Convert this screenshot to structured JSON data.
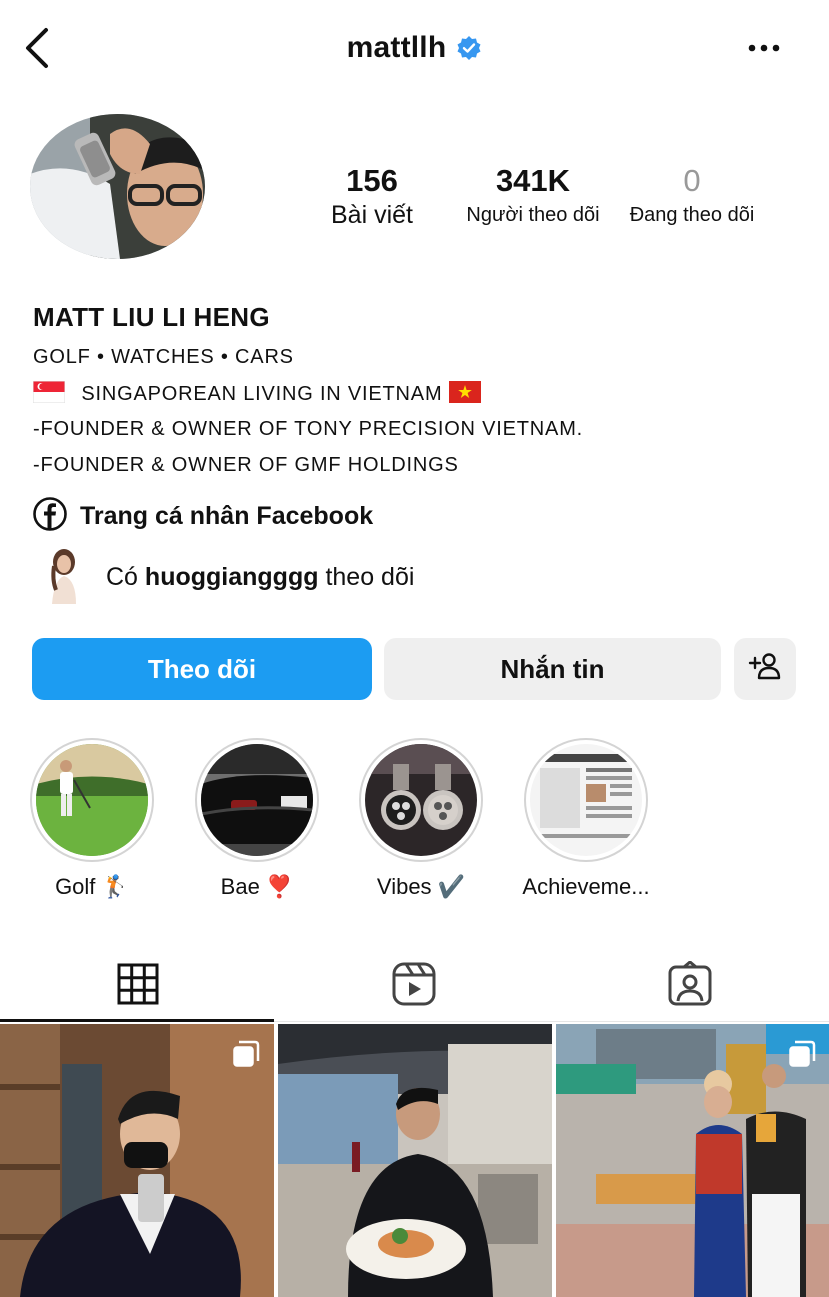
{
  "header": {
    "username": "mattllh"
  },
  "profile": {
    "stats": {
      "posts": {
        "value": "156",
        "label": "Bài viết"
      },
      "followers": {
        "value": "341K",
        "label": "Người theo dõi"
      },
      "following": {
        "value": "0",
        "label": "Đang theo dõi"
      }
    },
    "full_name": "MATT LIU LI HENG",
    "bio": {
      "line1": "GOLF • WATCHES • CARS",
      "line2": "SINGAPOREAN LIVING IN VIETNAM",
      "line3": "-FOUNDER & OWNER OF TONY PRECISION VIETNAM.",
      "line4": "-FOUNDER & OWNER OF GMF HOLDINGS"
    },
    "facebook_link": "Trang cá nhân Facebook",
    "followed_by": {
      "prefix": "Có",
      "username": "huoggiangggg",
      "suffix": "theo dõi"
    }
  },
  "actions": {
    "follow": "Theo dõi",
    "message": "Nhắn tin"
  },
  "highlights": [
    {
      "label": "Golf 🏌️"
    },
    {
      "label": "Bae ❣️"
    },
    {
      "label": "Vibes ✔️"
    },
    {
      "label": "Achieveme..."
    }
  ],
  "tabs": [
    {
      "icon": "grid-icon"
    },
    {
      "icon": "reels-icon"
    },
    {
      "icon": "tagged-icon"
    }
  ],
  "colors": {
    "accent": "#1c9cf2",
    "secondary_button": "#efefef",
    "verified": "#3797f0"
  }
}
